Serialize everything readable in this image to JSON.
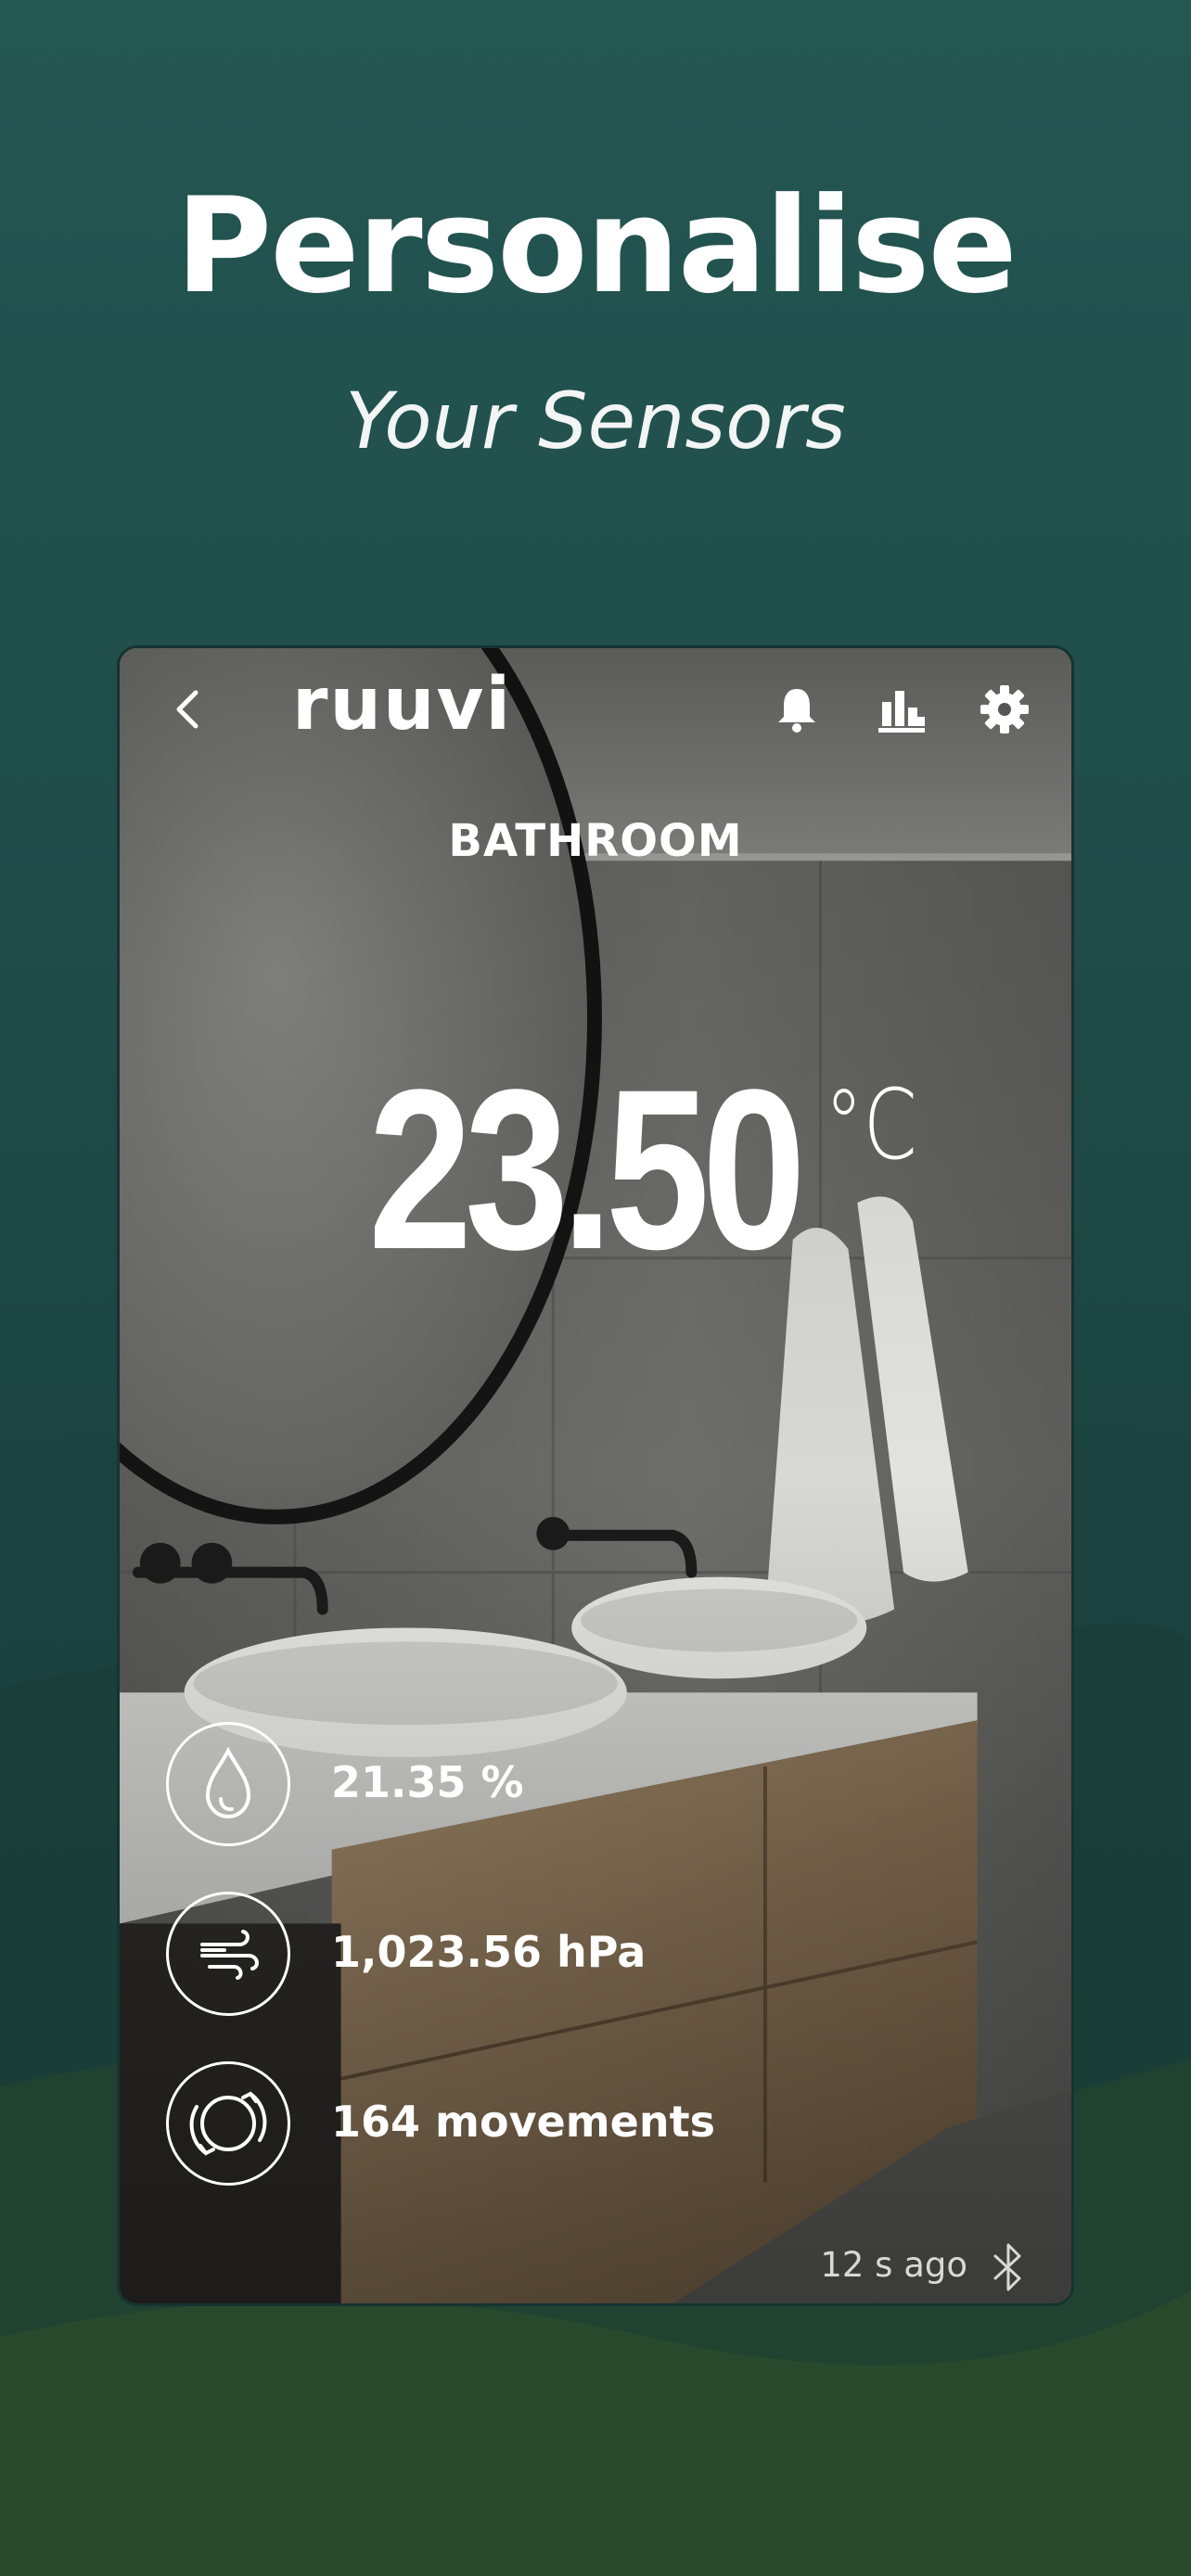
{
  "promo": {
    "headline": "Personalise",
    "subheadline": "Your Sensors"
  },
  "app_bar": {
    "back_icon": "chevron-left-icon",
    "logo": "ruuvi",
    "alerts_icon": "bell-icon",
    "graphs_icon": "bar-chart-icon",
    "settings_icon": "gear-icon"
  },
  "sensor": {
    "name": "BATHROOM",
    "temperature": "23.50",
    "temperature_unit": "°C",
    "humidity": "21.35 %",
    "pressure": "1,023.56 hPa",
    "movements": "164 movements",
    "updated": "12 s ago",
    "connection_icon": "bluetooth-icon"
  },
  "colors": {
    "background_top": "#245652",
    "background_bottom": "#1b3a2c",
    "text": "#ffffff"
  }
}
